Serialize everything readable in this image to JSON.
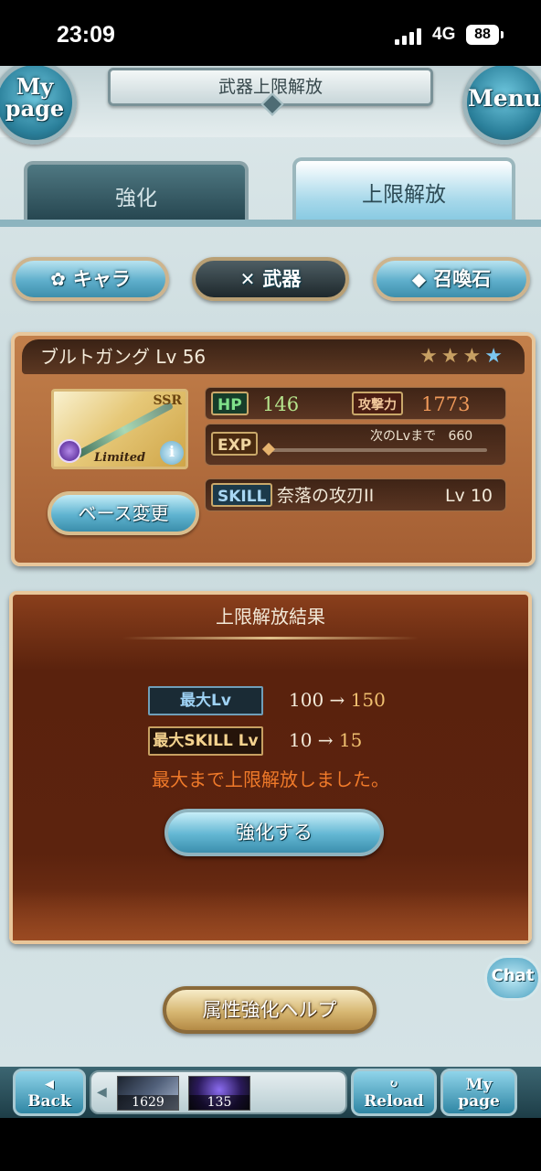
{
  "status_bar": {
    "time": "23:09",
    "network": "4G",
    "battery": "88"
  },
  "header": {
    "title": "武器上限解放",
    "mypage_btn": {
      "line1": "My",
      "line2": "page"
    },
    "menu_btn": "Menu"
  },
  "tabs": [
    {
      "label": "強化",
      "active": false
    },
    {
      "label": "上限解放",
      "active": true
    }
  ],
  "categories": [
    {
      "label": "キャラ",
      "icon": "chara-icon"
    },
    {
      "label": "武器",
      "icon": "weapon-icon",
      "active": true
    },
    {
      "label": "召喚石",
      "icon": "summon-icon"
    }
  ],
  "weapon": {
    "name": "ブルトガング Lv 56",
    "stars": [
      "★",
      "★",
      "★",
      "★"
    ],
    "rarity": "SSR",
    "tag": "Limited",
    "hp_label": "HP",
    "hp": "146",
    "atk_label": "攻撃力",
    "atk": "1773",
    "exp_label": "EXP",
    "next_level_text": "次のLvまで",
    "next_level_value": "660",
    "exp_fill": 0,
    "skill_label": "SKILL",
    "skill_name": "奈落の攻刃II",
    "skill_level": "Lv 10",
    "base_change_label": "ベース変更"
  },
  "result": {
    "title": "上限解放結果",
    "max_lv_label": "最大Lv",
    "max_lv_from": "100 →",
    "max_lv_to": "150",
    "max_skill_label": "最大SKILL Lv",
    "max_skill_from": "10 →",
    "max_skill_to": "15",
    "message": "最大まで上限解放しました。",
    "enhance_button": "強化する"
  },
  "chat_button": "Chat",
  "help_button": "属性強化ヘルプ",
  "footer": {
    "back": "Back",
    "items": [
      {
        "count": "1629"
      },
      {
        "count": "135"
      }
    ],
    "reload": "Reload",
    "mypage": {
      "line1": "My",
      "line2": "page"
    }
  },
  "colors": {
    "accent_blue": "#5fb3d0",
    "panel_brown": "#a45e33",
    "warn_orange": "#f07a2a"
  }
}
